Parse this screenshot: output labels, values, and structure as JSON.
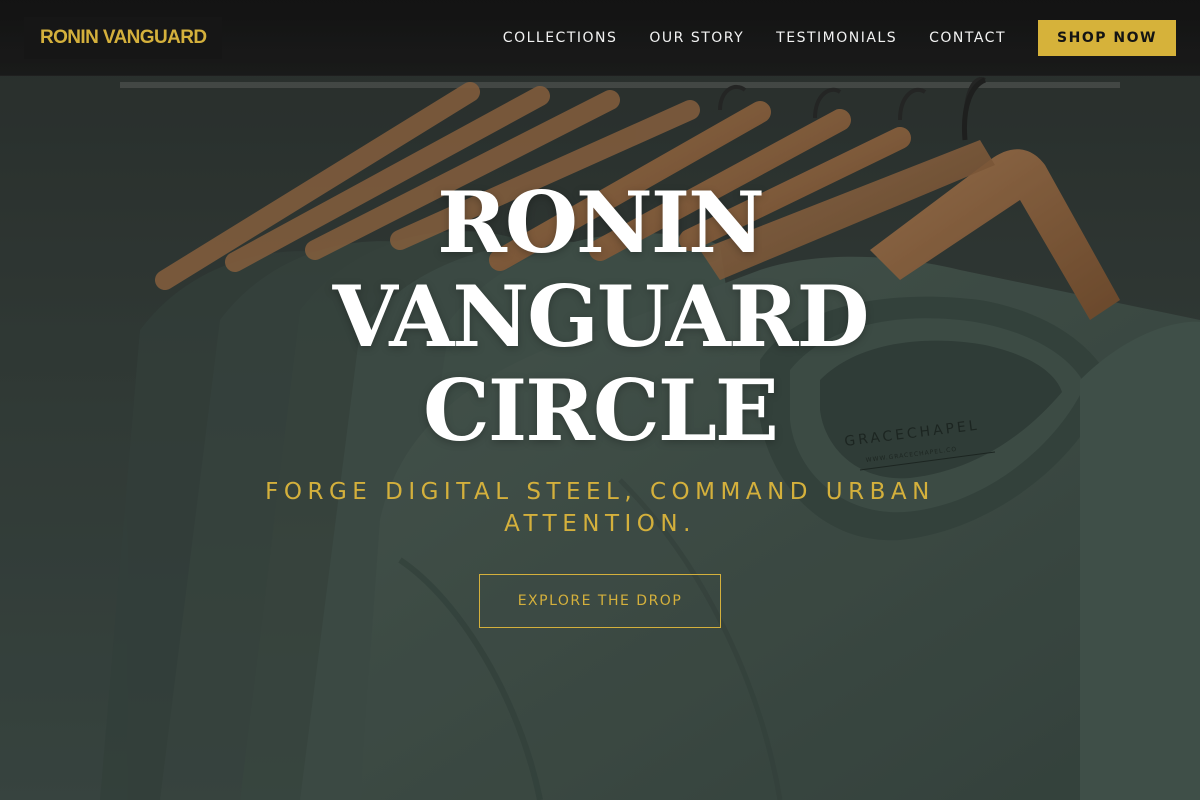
{
  "header": {
    "logo_text": "RONIN VANGUARD",
    "nav": [
      {
        "label": "COLLECTIONS"
      },
      {
        "label": "OUR STORY"
      },
      {
        "label": "TESTIMONIALS"
      },
      {
        "label": "CONTACT"
      }
    ],
    "shop_button": "SHOP NOW"
  },
  "hero": {
    "title_lines": [
      "RONIN",
      "VANGUARD",
      "CIRCLE"
    ],
    "tagline": "FORGE DIGITAL STEEL, COMMAND URBAN ATTENTION.",
    "cta_label": "EXPLORE THE DROP",
    "shirt_label_brand": "GRACECHAPEL",
    "shirt_label_url": "WWW.GRACECHAPEL.CO"
  },
  "colors": {
    "accent_gold": "#d4b03c",
    "header_bg": "#141414",
    "shirt_green": "#4a5e57"
  },
  "icons": [
    "hanger-icon",
    "shirt-image"
  ]
}
